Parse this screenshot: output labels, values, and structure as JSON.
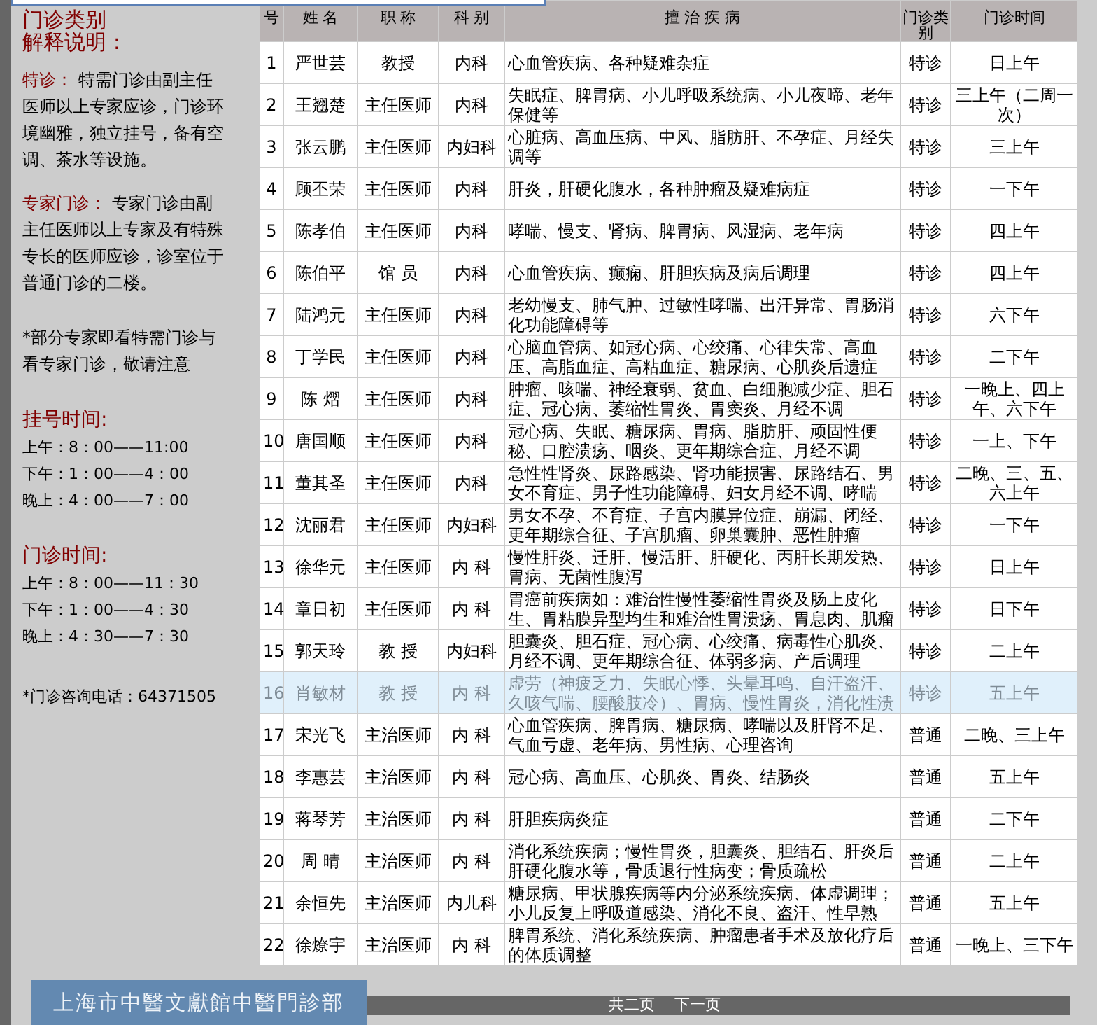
{
  "sidebar": {
    "heading": [
      "门诊类别",
      "解释说明："
    ],
    "terms": [
      {
        "label": "特诊：",
        "text": " 特需门诊由副主任医师以上专家应诊，门诊环境幽雅，独立挂号，备有空调、茶水等设施。"
      },
      {
        "label": "专家门诊：",
        "text": " 专家门诊由副主任医师以上专家及有特殊专长的医师应诊，诊室位于普通门诊的二楼。"
      }
    ],
    "note": "*部分专家即看特需门诊与看专家门诊，敬请注意",
    "schedules": [
      {
        "title": "挂号时间:",
        "lines": [
          "上午：8：00——11:00",
          "下午：1：00——4：00",
          "晚上：4：00——7：00"
        ]
      },
      {
        "title": "门诊时间:",
        "lines": [
          "上午：8：00——11：30",
          "下午：1：00——4：30",
          "晚上：4：30——7：30"
        ]
      }
    ],
    "phone": "*门诊咨询电话：64371505"
  },
  "table": {
    "columns": [
      "号",
      "姓 名",
      "职 称",
      "科 别",
      "擅 治 疾 病",
      "门诊类别",
      "门诊时间"
    ],
    "rows": [
      {
        "no": "1",
        "name": "严世芸",
        "title": "教授",
        "dept": "内科",
        "specialty": "心血管疾病、各种疑难杂症",
        "type": "特诊",
        "time": "日上午",
        "selected": false
      },
      {
        "no": "2",
        "name": "王翘楚",
        "title": "主任医师",
        "dept": "内科",
        "specialty": "失眠症、脾胃病、小儿呼吸系统病、小儿夜啼、老年保健等",
        "type": "特诊",
        "time": "三上午（二周一次）",
        "selected": false
      },
      {
        "no": "3",
        "name": "张云鹏",
        "title": "主任医师",
        "dept": "内妇科",
        "specialty": "心脏病、高血压病、中风、脂肪肝、不孕症、月经失调等",
        "type": "特诊",
        "time": "三上午",
        "selected": false
      },
      {
        "no": "4",
        "name": "顾丕荣",
        "title": "主任医师",
        "dept": "内科",
        "specialty": "肝炎，肝硬化腹水，各种肿瘤及疑难病症",
        "type": "特诊",
        "time": "一下午",
        "selected": false
      },
      {
        "no": "5",
        "name": "陈孝伯",
        "title": "主任医师",
        "dept": "内科",
        "specialty": "哮喘、慢支、肾病、脾胃病、风湿病、老年病",
        "type": "特诊",
        "time": "四上午",
        "selected": false
      },
      {
        "no": "6",
        "name": "陈伯平",
        "title": "馆 员",
        "dept": "内科",
        "specialty": "心血管疾病、癫痫、肝胆疾病及病后调理",
        "type": "特诊",
        "time": "四上午",
        "selected": false
      },
      {
        "no": "7",
        "name": "陆鸿元",
        "title": "主任医师",
        "dept": "内科",
        "specialty": "老幼慢支、肺气肿、过敏性哮喘、出汗异常、胃肠消化功能障碍等",
        "type": "特诊",
        "time": "六下午",
        "selected": false
      },
      {
        "no": "8",
        "name": "丁学民",
        "title": "主任医师",
        "dept": "内科",
        "specialty": "心脑血管病、如冠心病、心绞痛、心律失常、高血压、高脂血症、高粘血症、糖尿病、心肌炎后遗症",
        "type": "特诊",
        "time": "二下午",
        "selected": false
      },
      {
        "no": "9",
        "name": "陈 熠",
        "title": "主任医师",
        "dept": "内科",
        "specialty": "肿瘤、咳喘、神经衰弱、贫血、白细胞减少症、胆石症、冠心病、萎缩性胃炎、胃窦炎、月经不调",
        "type": "特诊",
        "time": "一晚上、四上午、六下午",
        "selected": false
      },
      {
        "no": "10",
        "name": "唐国顺",
        "title": "主任医师",
        "dept": "内科",
        "specialty": "冠心病、失眠、糖尿病、胃病、脂肪肝、顽固性便秘、口腔溃疡、咽炎、更年期综合症、月经不调",
        "type": "特诊",
        "time": "一上、下午",
        "selected": false
      },
      {
        "no": "11",
        "name": "董其圣",
        "title": "主任医师",
        "dept": "内科",
        "specialty": "急性性肾炎、尿路感染、肾功能损害、尿路结石、男女不育症、男子性功能障碍、妇女月经不调、哮喘",
        "type": "特诊",
        "time": "二晚、三、五、六上午",
        "selected": false
      },
      {
        "no": "12",
        "name": "沈丽君",
        "title": "主任医师",
        "dept": "内妇科",
        "specialty": "男女不孕、不育症、子宫内膜异位症、崩漏、闭经、更年期综合征、子宫肌瘤、卵巢囊肿、恶性肿瘤",
        "type": "特诊",
        "time": "一下午",
        "selected": false
      },
      {
        "no": "13",
        "name": "徐华元",
        "title": "主任医师",
        "dept": "内 科",
        "specialty": "慢性肝炎、迁肝、慢活肝、肝硬化、丙肝长期发热、胃病、无菌性腹泻",
        "type": "特诊",
        "time": "日上午",
        "selected": false
      },
      {
        "no": "14",
        "name": "章日初",
        "title": "主任医师",
        "dept": "内 科",
        "specialty": "胃癌前疾病如：难治性慢性萎缩性胃炎及肠上皮化生、胃粘膜异型均生和难治性胃溃疡、胃息肉、肌瘤",
        "type": "特诊",
        "time": "日下午",
        "selected": false
      },
      {
        "no": "15",
        "name": "郭天玲",
        "title": "教 授",
        "dept": "内妇科",
        "specialty": "胆囊炎、胆石症、冠心病、心绞痛、病毒性心肌炎、月经不调、更年期综合征、体弱多病、产后调理",
        "type": "特诊",
        "time": "二上午",
        "selected": false
      },
      {
        "no": "16",
        "name": "肖敏材",
        "title": "教 授",
        "dept": "内 科",
        "specialty": "虚劳（神疲乏力、失眠心悸、头晕耳鸣、自汗盗汗、久咳气喘、腰酸肢冷）、胃病、慢性胃炎，消化性溃",
        "type": "特诊",
        "time": "五上午",
        "selected": true
      },
      {
        "no": "17",
        "name": "宋光飞",
        "title": "主治医师",
        "dept": "内 科",
        "specialty": "心血管疾病、脾胃病、糖尿病、哮喘以及肝肾不足、气血亏虚、老年病、男性病、心理咨询",
        "type": "普通",
        "time": "二晚、三上午",
        "selected": false
      },
      {
        "no": "18",
        "name": "李惠芸",
        "title": "主治医师",
        "dept": "内 科",
        "specialty": "冠心病、高血压、心肌炎、胃炎、结肠炎",
        "type": "普通",
        "time": "五上午",
        "selected": false
      },
      {
        "no": "19",
        "name": "蒋琴芳",
        "title": "主治医师",
        "dept": "内 科",
        "specialty": "肝胆疾病炎症",
        "type": "普通",
        "time": "二下午",
        "selected": false
      },
      {
        "no": "20",
        "name": "周 晴",
        "title": "主治医师",
        "dept": "内 科",
        "specialty": "消化系统疾病；慢性胃炎，胆囊炎、胆结石、肝炎后肝硬化腹水等，骨质退行性病变；骨质疏松",
        "type": "普通",
        "time": "二上午",
        "selected": false
      },
      {
        "no": "21",
        "name": "余恒先",
        "title": "主治医师",
        "dept": "内儿科",
        "specialty": "糖尿病、甲状腺疾病等内分泌系统疾病、体虚调理；小儿反复上呼吸道感染、消化不良、盗汗、性早熟",
        "type": "普通",
        "time": "五上午",
        "selected": false
      },
      {
        "no": "22",
        "name": "徐燎宇",
        "title": "主治医师",
        "dept": "内 科",
        "specialty": "脾胃系统、消化系统疾病、肿瘤患者手术及放化疗后的体质调整",
        "type": "普通",
        "time": "一晚上、三下午",
        "selected": false
      }
    ]
  },
  "pager": {
    "summary": "共二页",
    "next": "下一页"
  },
  "logo": {
    "text": "上海市中醫文獻館中醫門診部"
  }
}
